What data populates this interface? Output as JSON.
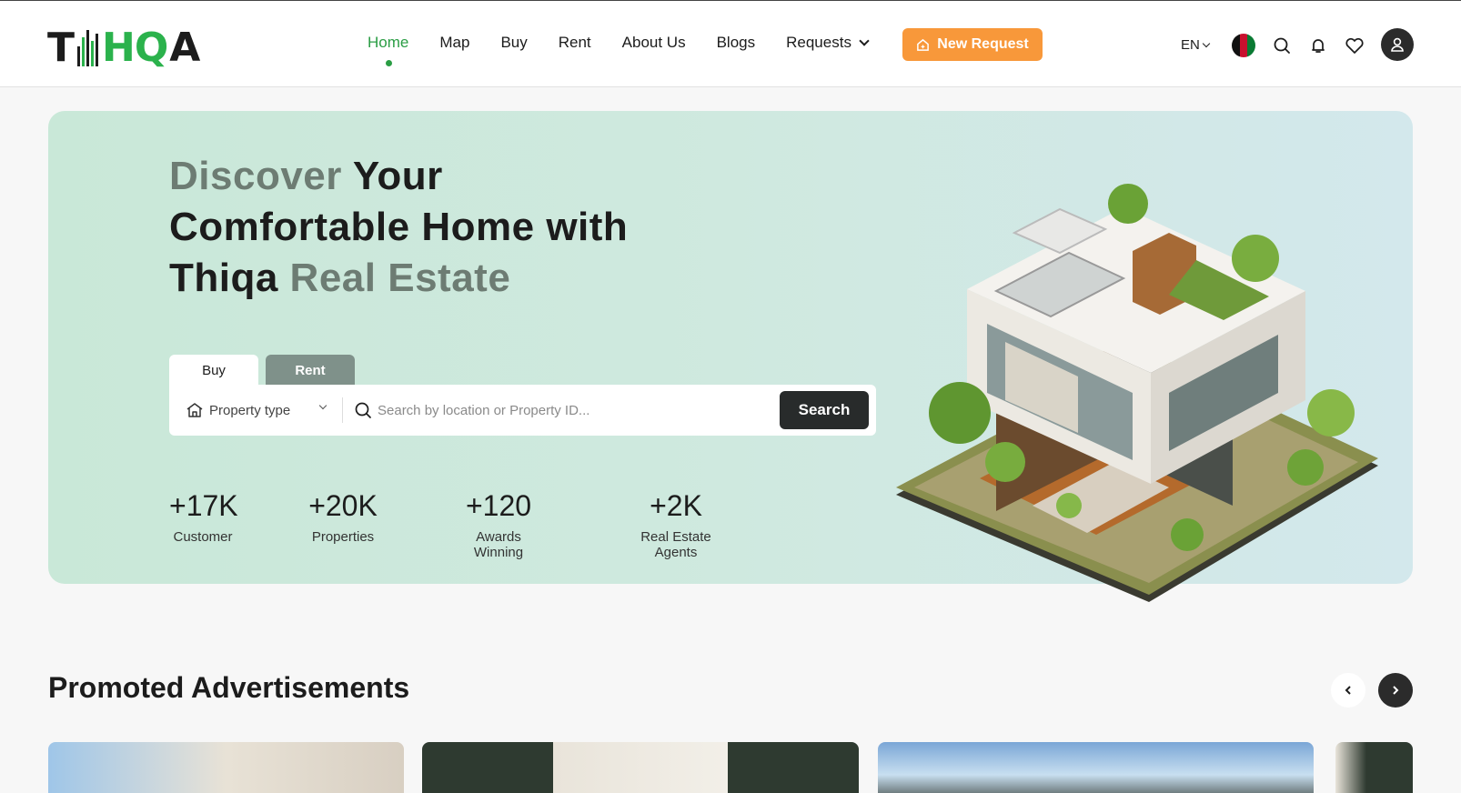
{
  "brand": {
    "logo_text_left": "T",
    "logo_text_mid": "HQ",
    "logo_text_right": "A",
    "colors": {
      "green": "#2bb24c",
      "orange": "#f8983a",
      "dark": "#282b2b"
    }
  },
  "nav": {
    "items": [
      {
        "label": "Home",
        "active": true
      },
      {
        "label": "Map"
      },
      {
        "label": "Buy"
      },
      {
        "label": "Rent"
      },
      {
        "label": "About Us"
      },
      {
        "label": "Blogs"
      },
      {
        "label": "Requests",
        "dropdown": true
      }
    ],
    "new_request": "New Request",
    "language": "EN",
    "icons": [
      "flag-icon",
      "search-icon",
      "bell-icon",
      "heart-icon",
      "user-icon"
    ]
  },
  "hero": {
    "line1_muted": "Discover",
    "line1_rest": " Your",
    "line2": "Comfortable Home with",
    "line3_main": "Thiqa",
    "line3_muted": " Real Estate",
    "tabs": {
      "buy": "Buy",
      "rent": "Rent"
    },
    "property_type": "Property type",
    "search_placeholder": "Search by location or Property ID...",
    "search_button": "Search",
    "stats": [
      {
        "value": "+17K",
        "label": "Customer"
      },
      {
        "value": "+20K",
        "label": "Properties"
      },
      {
        "value": "+120",
        "label": "Awards Winning"
      },
      {
        "value": "+2K",
        "label": "Real Estate Agents"
      }
    ]
  },
  "promoted": {
    "title": "Promoted Advertisements"
  }
}
